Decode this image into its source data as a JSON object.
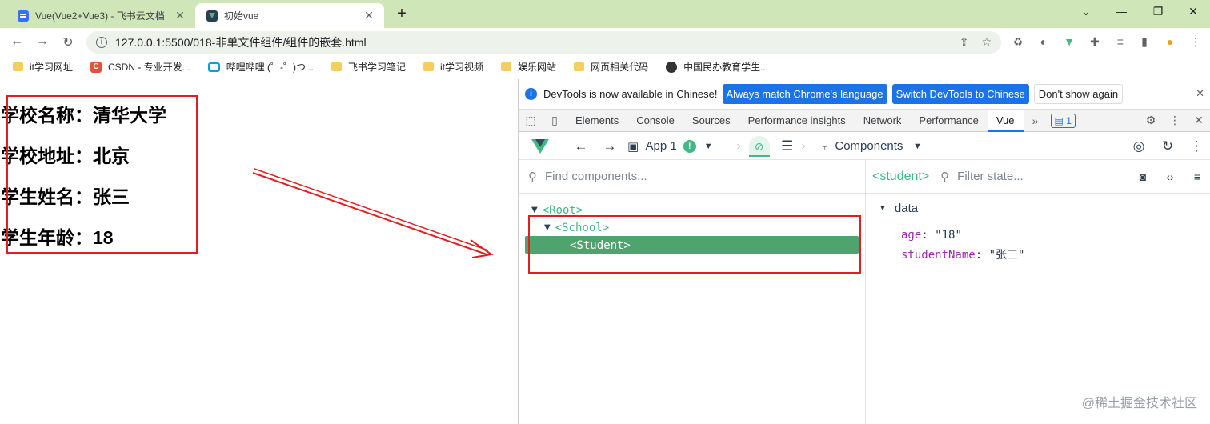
{
  "browser": {
    "tabs": [
      {
        "title": "Vue(Vue2+Vue3) - 飞书云文档",
        "icon": "feishu-doc-icon"
      },
      {
        "title": "初始vue",
        "icon": "vue-icon"
      }
    ],
    "url": "127.0.0.1:5500/018-非单文件组件/组件的嵌套.html",
    "bookmarks": [
      "it学习网址",
      "CSDN - 专业开发...",
      "哔哩哔哩 (゜-゜)つ...",
      "飞书学习笔记",
      "it学习视频",
      "娱乐网站",
      "网页相关代码",
      "中国民办教育学生..."
    ]
  },
  "page": {
    "school_name_label": "学校名称：",
    "school_name": "清华大学",
    "school_addr_label": "学校地址：",
    "school_addr": "北京",
    "student_name_label": "学生姓名：",
    "student_name": "张三",
    "student_age_label": "学生年龄：",
    "student_age": "18"
  },
  "devtools": {
    "infobar": {
      "message": "DevTools is now available in Chinese!",
      "btn_match": "Always match Chrome's language",
      "btn_switch": "Switch DevTools to Chinese",
      "btn_dismiss": "Don't show again"
    },
    "tabs": [
      "Elements",
      "Console",
      "Sources",
      "Performance insights",
      "Network",
      "Performance",
      "Vue"
    ],
    "active_tab": "Vue",
    "issues_count": "1",
    "vue": {
      "app_label": "App 1",
      "components_label": "Components",
      "search_placeholder": "Find components...",
      "tree": {
        "root": "<Root>",
        "school": "<School>",
        "student": "<Student>"
      },
      "selected_component": "<student>",
      "filter_placeholder": "Filter state...",
      "section": "data",
      "props": [
        {
          "key": "age",
          "value": "\"18\""
        },
        {
          "key": "studentName",
          "value": "\"张三\""
        }
      ]
    }
  },
  "watermark": "@稀土掘金技术社区",
  "colors": {
    "highlight_red": "#e02020",
    "vue_green": "#42b883",
    "selected_row": "#4fa36e"
  }
}
